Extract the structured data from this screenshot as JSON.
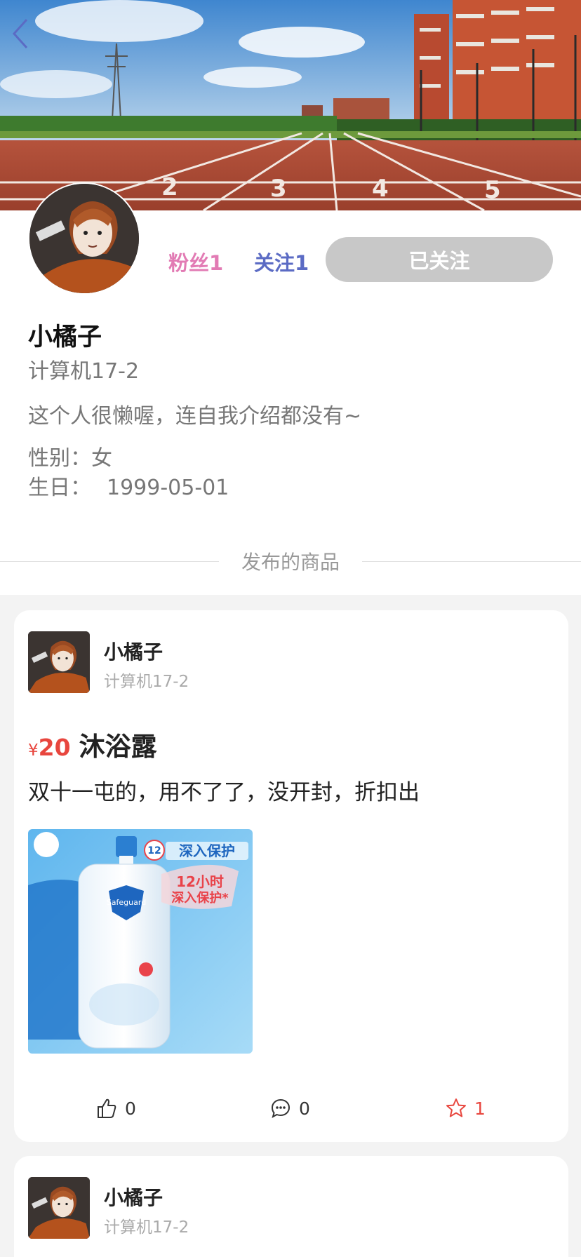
{
  "header": {
    "back_label": "返回"
  },
  "profile": {
    "fans_label": "粉丝",
    "fans_count": "1",
    "follows_label": "关注",
    "follows_count": "1",
    "follow_button": "已关注",
    "name": "小橘子",
    "class": "计算机17-2",
    "bio": "这个人很懒喔，连自我介绍都没有~",
    "gender_label": "性别：",
    "gender": "女",
    "birthday_label": "生日：",
    "birthday": "1999-05-01"
  },
  "section": {
    "title": "发布的商品"
  },
  "posts": [
    {
      "author": "小橘子",
      "author_class": "计算机17-2",
      "price_symbol": "¥",
      "price": "20",
      "title": "沐浴露",
      "description": "双十一屯的，用不了了，没开封，折扣出",
      "likes": "0",
      "comments": "0",
      "favorites": "1",
      "image_text": {
        "brand": "Safeguard",
        "badge": "12",
        "tagline": "深入保护",
        "big_line1": "12小时",
        "big_line2": "深入保护*"
      }
    },
    {
      "author": "小橘子",
      "author_class": "计算机17-2"
    }
  ],
  "colors": {
    "fans": "#e27bb4",
    "follows": "#5b6bc4",
    "price": "#e8463e",
    "follow_button_bg": "#c8c8c8",
    "back_icon": "#5b6bc4"
  }
}
